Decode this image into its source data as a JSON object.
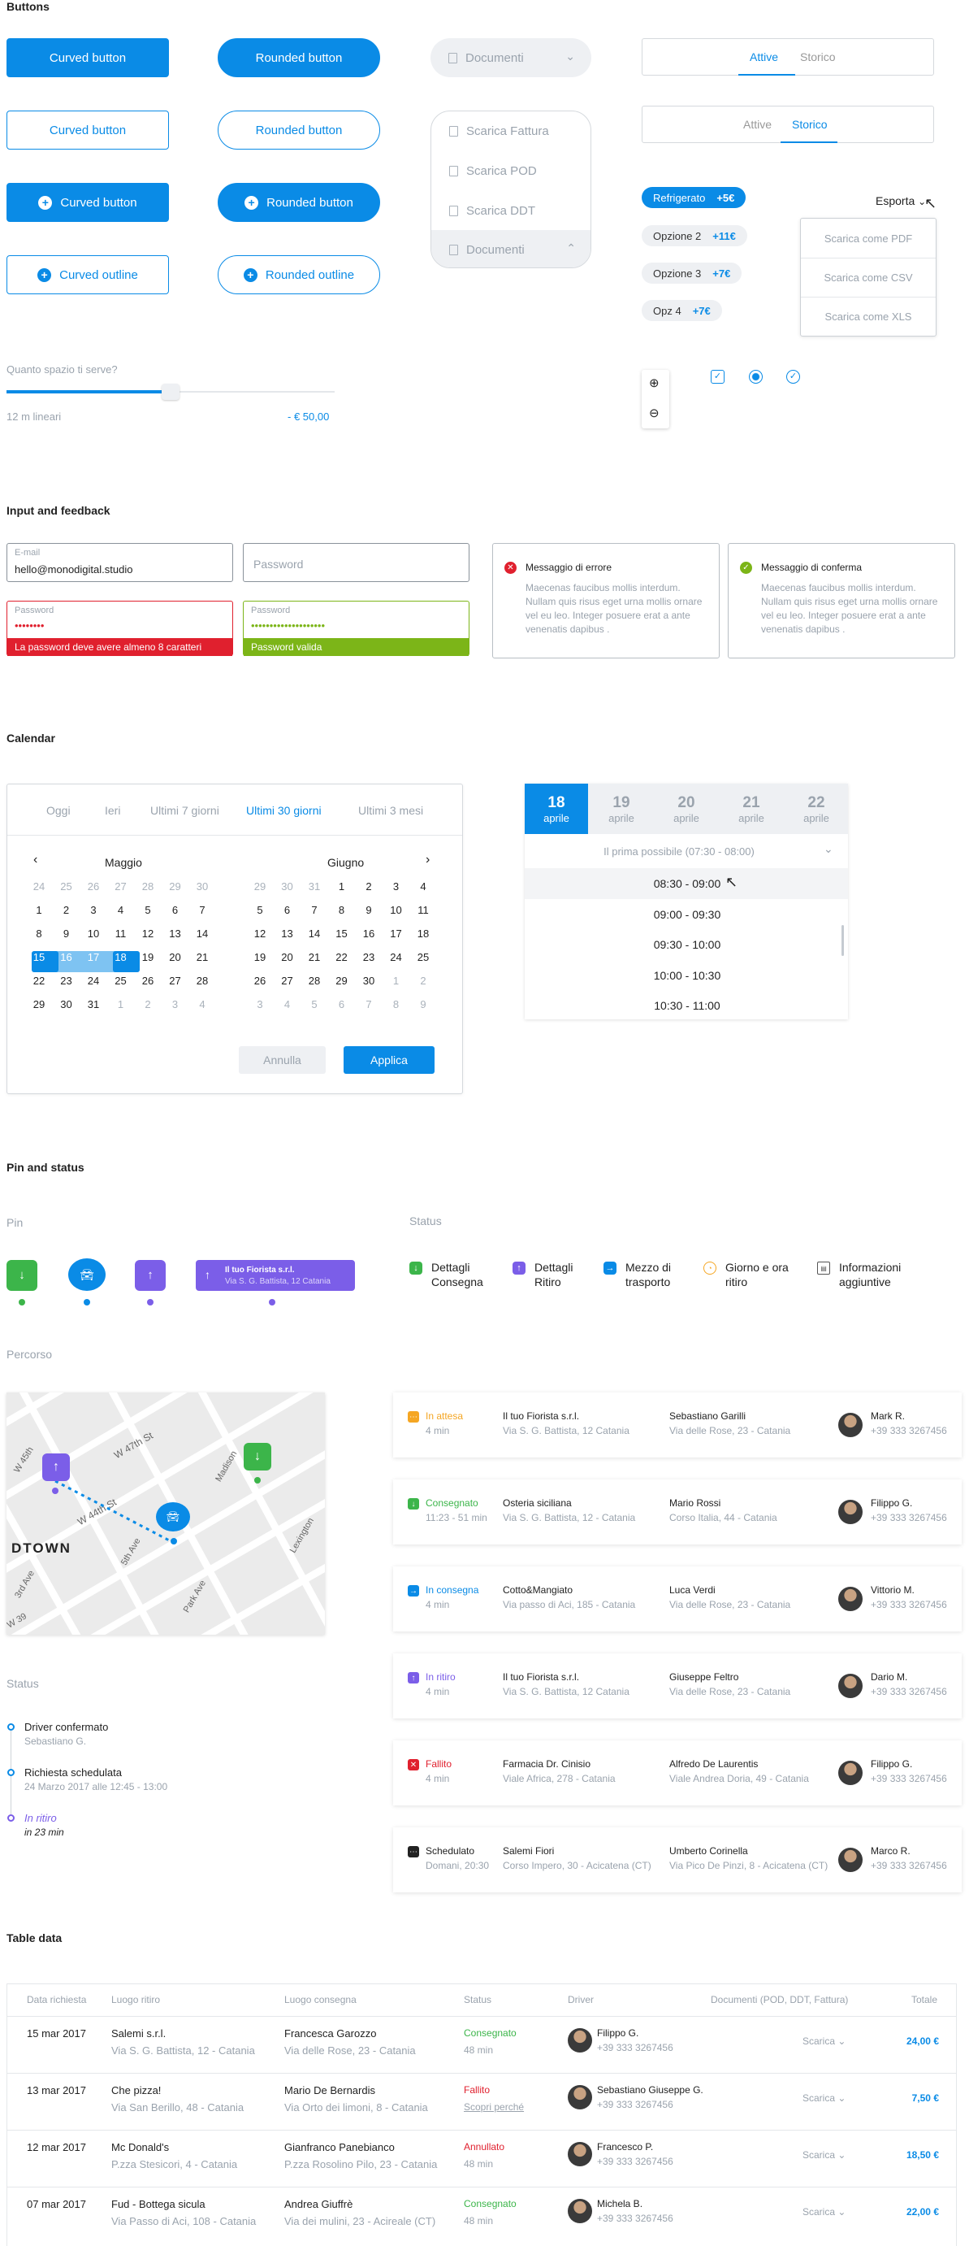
{
  "sections": {
    "buttons": "Buttons",
    "input": "Input and feedback",
    "calendar": "Calendar",
    "pin": "Pin and status",
    "table": "Table data"
  },
  "buttons": {
    "curved": "Curved button",
    "rounded": "Rounded button",
    "curved_outline": "Curved outline",
    "rounded_outline": "Rounded outline"
  },
  "documenti": {
    "label": "Documenti",
    "items": [
      "Scarica Fattura",
      "Scarica POD",
      "Scarica DDT"
    ]
  },
  "tabs": {
    "attive": "Attive",
    "storico": "Storico"
  },
  "chips": [
    {
      "label": "Refrigerato",
      "price": "+5€"
    },
    {
      "label": "Opzione 2",
      "price": "+11€"
    },
    {
      "label": "Opzione 3",
      "price": "+7€"
    },
    {
      "label": "Opz 4",
      "price": "+7€"
    }
  ],
  "esporta": {
    "label": "Esporta",
    "items": [
      "Scarica come PDF",
      "Scarica come CSV",
      "Scarica come XLS"
    ]
  },
  "slider": {
    "question": "Quanto spazio ti serve?",
    "value": "12 m lineari",
    "price": "- € 50,00",
    "level": 0.5
  },
  "inputs": {
    "email_label": "E-mail",
    "email_value": "hello@monodigital.studio",
    "password_placeholder": "Password",
    "pw_label": "Password",
    "pw_error_value": "••••••••",
    "pw_error_msg": "La password deve avere almeno 8 caratteri",
    "pw_ok_value": "••••••••••••••••••••",
    "pw_ok_msg": "Password valida"
  },
  "feedback": {
    "error_title": "Messaggio di errore",
    "ok_title": "Messaggio di conferma",
    "body": "Maecenas faucibus mollis interdum. Nullam quis risus eget urna mollis ornare vel eu leo. Integer posuere erat a ante venenatis dapibus ."
  },
  "calendar": {
    "tabs": [
      "Oggi",
      "Ieri",
      "Ultimi 7 giorni",
      "Ultimi 30 giorni",
      "Ultimi 3 mesi"
    ],
    "month1": "Maggio",
    "month2": "Giugno",
    "may": [
      [
        "24",
        "25",
        "26",
        "27",
        "28",
        "29",
        "30"
      ],
      [
        "1",
        "2",
        "3",
        "4",
        "5",
        "6",
        "7"
      ],
      [
        "8",
        "9",
        "10",
        "11",
        "12",
        "13",
        "14"
      ],
      [
        "15",
        "16",
        "17",
        "18",
        "19",
        "20",
        "21"
      ],
      [
        "22",
        "23",
        "24",
        "25",
        "26",
        "27",
        "28"
      ],
      [
        "29",
        "30",
        "31",
        "1",
        "2",
        "3",
        "4"
      ]
    ],
    "june": [
      [
        "29",
        "30",
        "31",
        "1",
        "2",
        "3",
        "4"
      ],
      [
        "5",
        "6",
        "7",
        "8",
        "9",
        "10",
        "11"
      ],
      [
        "12",
        "13",
        "14",
        "15",
        "16",
        "17",
        "18"
      ],
      [
        "19",
        "20",
        "21",
        "22",
        "23",
        "24",
        "25"
      ],
      [
        "26",
        "27",
        "28",
        "29",
        "30",
        "1",
        "2"
      ],
      [
        "3",
        "4",
        "5",
        "6",
        "7",
        "8",
        "9"
      ]
    ],
    "cancel": "Annulla",
    "apply": "Applica"
  },
  "picker": {
    "days": [
      {
        "n": "18",
        "m": "aprile"
      },
      {
        "n": "19",
        "m": "aprile"
      },
      {
        "n": "20",
        "m": "aprile"
      },
      {
        "n": "21",
        "m": "aprile"
      },
      {
        "n": "22",
        "m": "aprile"
      }
    ],
    "first": "Il prima possibile (07:30 - 08:00)",
    "slots": [
      "08:30 - 09:00",
      "09:00 - 09:30",
      "09:30 - 10:00",
      "10:00 - 10:30",
      "10:30 - 11:00"
    ]
  },
  "pin": {
    "pin_label": "Pin",
    "status_label": "Status",
    "tag_title": "Il tuo Fiorista s.r.l.",
    "tag_sub": "Via S. G. Battista, 12 Catania",
    "statuses": [
      "Dettagli Consegna",
      "Dettagli Ritiro",
      "Mezzo di trasporto",
      "Giorno e ora ritiro",
      "Informazioni aggiuntive"
    ]
  },
  "percorso": {
    "label": "Percorso",
    "map_labels": [
      "W 45th",
      "W 47th St",
      "W 44th St",
      "5th Ave",
      "Park Ave",
      "Madison",
      "Lexington",
      "DTOWN",
      "3rd Ave",
      "W 39"
    ]
  },
  "timeline": {
    "label": "Status",
    "items": [
      {
        "t": "Driver confermato",
        "s": "Sebastiano G."
      },
      {
        "t": "Richiesta schedulata",
        "s": "24 Marzo 2017 alle 12:45 - 13:00"
      },
      {
        "t": "In ritiro",
        "s": "in 23 min"
      }
    ]
  },
  "orders": [
    {
      "status": "In attesa",
      "sub": "4 min",
      "color": "#f5a623",
      "from": "Il tuo Fiorista s.r.l.",
      "fromAddr": "Via S. G. Battista, 12 Catania",
      "to": "Sebastiano Garilli",
      "toAddr": "Via delle Rose, 23 - Catania",
      "driver": "Mark R.",
      "phone": "+39 333 3267456"
    },
    {
      "status": "Consegnato",
      "sub": "11:23 - 51 min",
      "color": "#3cb54a",
      "from": "Osteria siciliana",
      "fromAddr": "Via S. G. Battista, 12 - Catania",
      "to": "Mario Rossi",
      "toAddr": "Corso Italia, 44 - Catania",
      "driver": "Filippo G.",
      "phone": "+39 333 3267456"
    },
    {
      "status": "In consegna",
      "sub": "4 min",
      "color": "#0a8be6",
      "from": "Cotto&Mangiato",
      "fromAddr": "Via passo di Aci, 185 - Catania",
      "to": "Luca Verdi",
      "toAddr": "Via delle Rose, 23 - Catania",
      "driver": "Vittorio M.",
      "phone": "+39 333 3267456"
    },
    {
      "status": "In ritiro",
      "sub": "4 min",
      "color": "#7b5ee8",
      "from": "Il tuo Fiorista s.r.l.",
      "fromAddr": "Via S. G. Battista, 12 Catania",
      "to": "Giuseppe Feltro",
      "toAddr": "Via delle Rose, 23 - Catania",
      "driver": "Dario M.",
      "phone": "+39 333 3267456"
    },
    {
      "status": "Fallito",
      "sub": "4 min",
      "color": "#e0202e",
      "from": "Farmacia Dr. Cinisio",
      "fromAddr": "Viale Africa, 278 - Catania",
      "to": "Alfredo De Laurentis",
      "toAddr": "Viale Andrea Doria, 49 - Catania",
      "driver": "Filippo G.",
      "phone": "+39 333 3267456"
    },
    {
      "status": "Schedulato",
      "sub": "Domani, 20:30",
      "color": "#222222",
      "from": "Salemi Fiori",
      "fromAddr": "Corso Impero, 30 - Acicatena (CT)",
      "to": "Umberto Corinella",
      "toAddr": "Via Pico De Pinzi, 8 - Acicatena (CT)",
      "driver": "Marco R.",
      "phone": "+39 333 3267456"
    }
  ],
  "table": {
    "headers": [
      "Data richiesta",
      "Luogo ritiro",
      "Luogo consegna",
      "Status",
      "Driver",
      "Documenti (POD, DDT, Fattura)",
      "Totale"
    ],
    "rows": [
      {
        "date": "15 mar 2017",
        "from": "Salemi s.r.l.",
        "fromAddr": "Via S. G. Battista, 12 - Catania",
        "to": "Francesca Garozzo",
        "toAddr": "Via delle Rose, 23 - Catania",
        "status": "Consegnato",
        "statusSub": "48 min",
        "color": "#3cb54a",
        "driver": "Filippo G.",
        "phone": "+39 333 3267456",
        "doc": "Scarica",
        "total": "24,00 €"
      },
      {
        "date": "13 mar 2017",
        "from": "Che pizza!",
        "fromAddr": "Via San Berillo, 48 - Catania",
        "to": "Mario De Bernardis",
        "toAddr": "Via Orto dei limoni, 8 - Catania",
        "status": "Fallito",
        "statusSub": "Scopri perché",
        "color": "#e0202e",
        "driver": "Sebastiano Giuseppe G.",
        "phone": "+39 333 3267456",
        "doc": "Scarica",
        "total": "7,50 €"
      },
      {
        "date": "12 mar 2017",
        "from": "Mc Donald's",
        "fromAddr": "P.zza Stesicori, 4 - Catania",
        "to": "Gianfranco Panebianco",
        "toAddr": "P.zza Rosolino Pilo, 23 - Catania",
        "status": "Annullato",
        "statusSub": "48 min",
        "color": "#e0202e",
        "driver": "Francesco P.",
        "phone": "+39 333 3267456",
        "doc": "Scarica",
        "total": "18,50 €"
      },
      {
        "date": "07 mar 2017",
        "from": "Fud - Bottega sicula",
        "fromAddr": "Via Passo di Aci, 108 - Catania",
        "to": "Andrea Giuffrè",
        "toAddr": "Via dei mulini, 23 - Acireale (CT)",
        "status": "Consegnato",
        "statusSub": "48 min",
        "color": "#3cb54a",
        "driver": "Michela B.",
        "phone": "+39 333 3267456",
        "doc": "Scarica",
        "total": "22,00 €"
      }
    ]
  }
}
